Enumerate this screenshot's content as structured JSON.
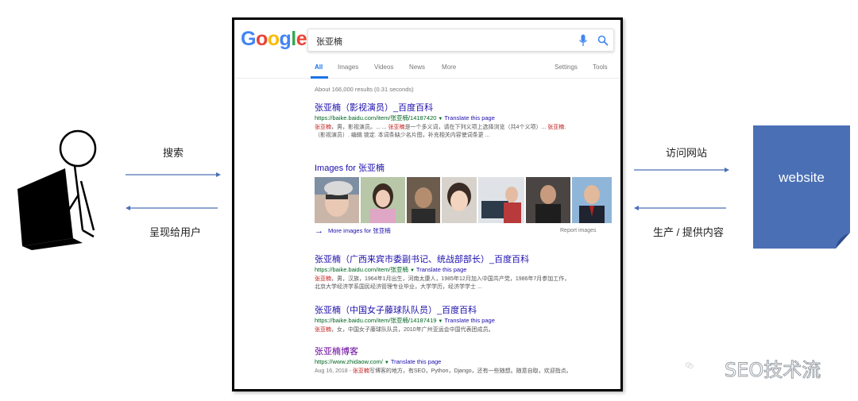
{
  "flow": {
    "search_label": "搜索",
    "present_label": "呈现给用户",
    "visit_label": "访问网站",
    "produce_label": "生产 / 提供内容",
    "website_label": "website"
  },
  "google": {
    "logo_letters": [
      "G",
      "o",
      "o",
      "g",
      "l",
      "e"
    ],
    "logo_colors": [
      "#4285F4",
      "#EA4335",
      "#FBBC05",
      "#4285F4",
      "#34A853",
      "#EA4335"
    ],
    "search_query": "张亚楠",
    "tabs": [
      "All",
      "Images",
      "Videos",
      "News",
      "More"
    ],
    "settings_label": "Settings",
    "tools_label": "Tools",
    "result_stats": "About 166,000 results (0.31 seconds)",
    "translate_label": "Translate this page",
    "results": [
      {
        "title": "张亚楠（影视演员）_百度百科",
        "url": "https://baike.baidu.com/item/张亚楠/14187420",
        "snippet1_hl": "张亚楠",
        "snippet1": "，男，影视演员。... ... ",
        "snippet1_hl2": "张亚楠",
        "snippet1_b": "是一个多义词，请在下列义项上选择浏览（共4个义项）...",
        "snippet1_hl3": "张亚楠",
        "snippet1_c": ".",
        "snippet2": "（影视演员）. 编辑 锁定. 本词条缺少名片图，补充相关内容使词条更 ..."
      },
      {
        "title": "张亚楠（广西来宾市委副书记、统战部部长）_百度百科",
        "url": "https://baike.baidu.com/item/张亚楠",
        "snippet1_hl": "张亚楠",
        "snippet1": "，男，汉族，1964年1月出生，河南太康人，1985年12月加入中国共产党，1986年7月参加工作，",
        "snippet2": "北京大学经济学系国民经济管理专业毕业，大学学历，经济学学士 ..."
      },
      {
        "title": "张亚楠（中国女子藤球队队员）_百度百科",
        "url": "https://baike.baidu.com/item/张亚楠/14187419",
        "snippet1_hl": "张亚楠",
        "snippet1": "，女，中国女子藤球队队员，2010年广州亚运会中国代表团成员。"
      },
      {
        "title": "张亚楠博客",
        "url": "https://www.zhidaow.com/",
        "snippet_date": "Aug 16, 2018 - ",
        "snippet1_hl": "张亚楠",
        "snippet1": "写博客的地方，有SEO，Python，Django，还有一些随想。随意自取，欢迎指点。"
      }
    ],
    "images_heading": "Images for 张亚楠",
    "more_images": "More images for 张亚楠",
    "report_images": "Report images"
  },
  "watermark": {
    "text": "SEO技术流"
  },
  "colors": {
    "arrow": "#4a6fb5",
    "website_fill": "#4a6fb5",
    "link_blue": "#1a0dab",
    "url_green": "#006621",
    "highlight_red": "#c5221f"
  }
}
